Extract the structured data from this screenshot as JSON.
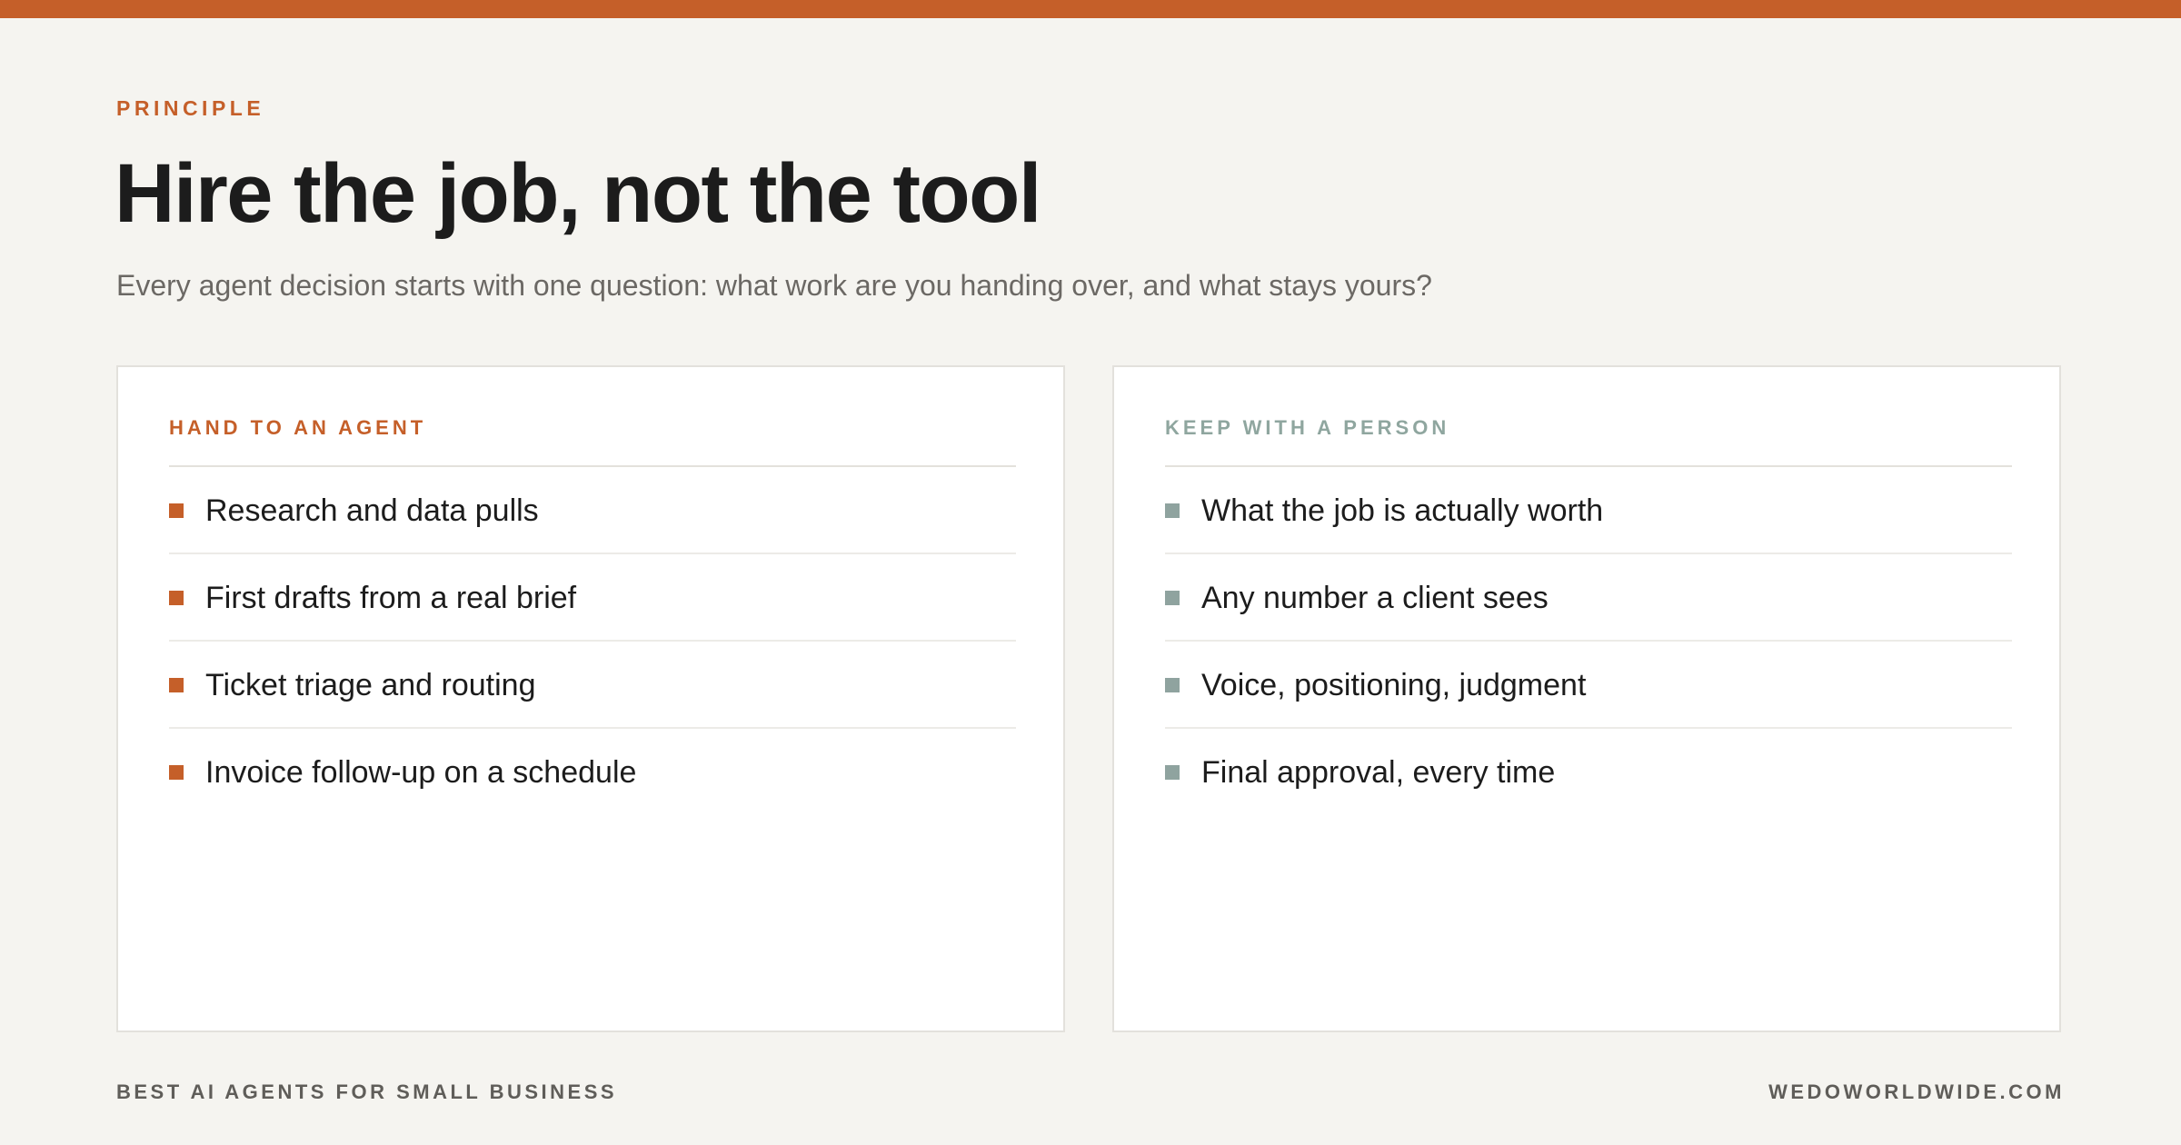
{
  "colors": {
    "accent": "#c55f29",
    "secondary": "#8fa39f",
    "background": "#f5f4f0",
    "card": "#ffffff"
  },
  "eyebrow": "PRINCIPLE",
  "title": "Hire the job, not the tool",
  "subtitle": "Every agent decision starts with one question: what work are you handing over, and what stays yours?",
  "cards": {
    "agent": {
      "label": "HAND TO AN AGENT",
      "items": [
        "Research and data pulls",
        "First drafts from a real brief",
        "Ticket triage and routing",
        "Invoice follow-up on a schedule"
      ]
    },
    "person": {
      "label": "KEEP WITH A PERSON",
      "items": [
        "What the job is actually worth",
        "Any number a client sees",
        "Voice, positioning, judgment",
        "Final approval, every time"
      ]
    }
  },
  "footer": {
    "left": "BEST AI AGENTS FOR SMALL BUSINESS",
    "right": "WEDOWORLDWIDE.COM"
  }
}
